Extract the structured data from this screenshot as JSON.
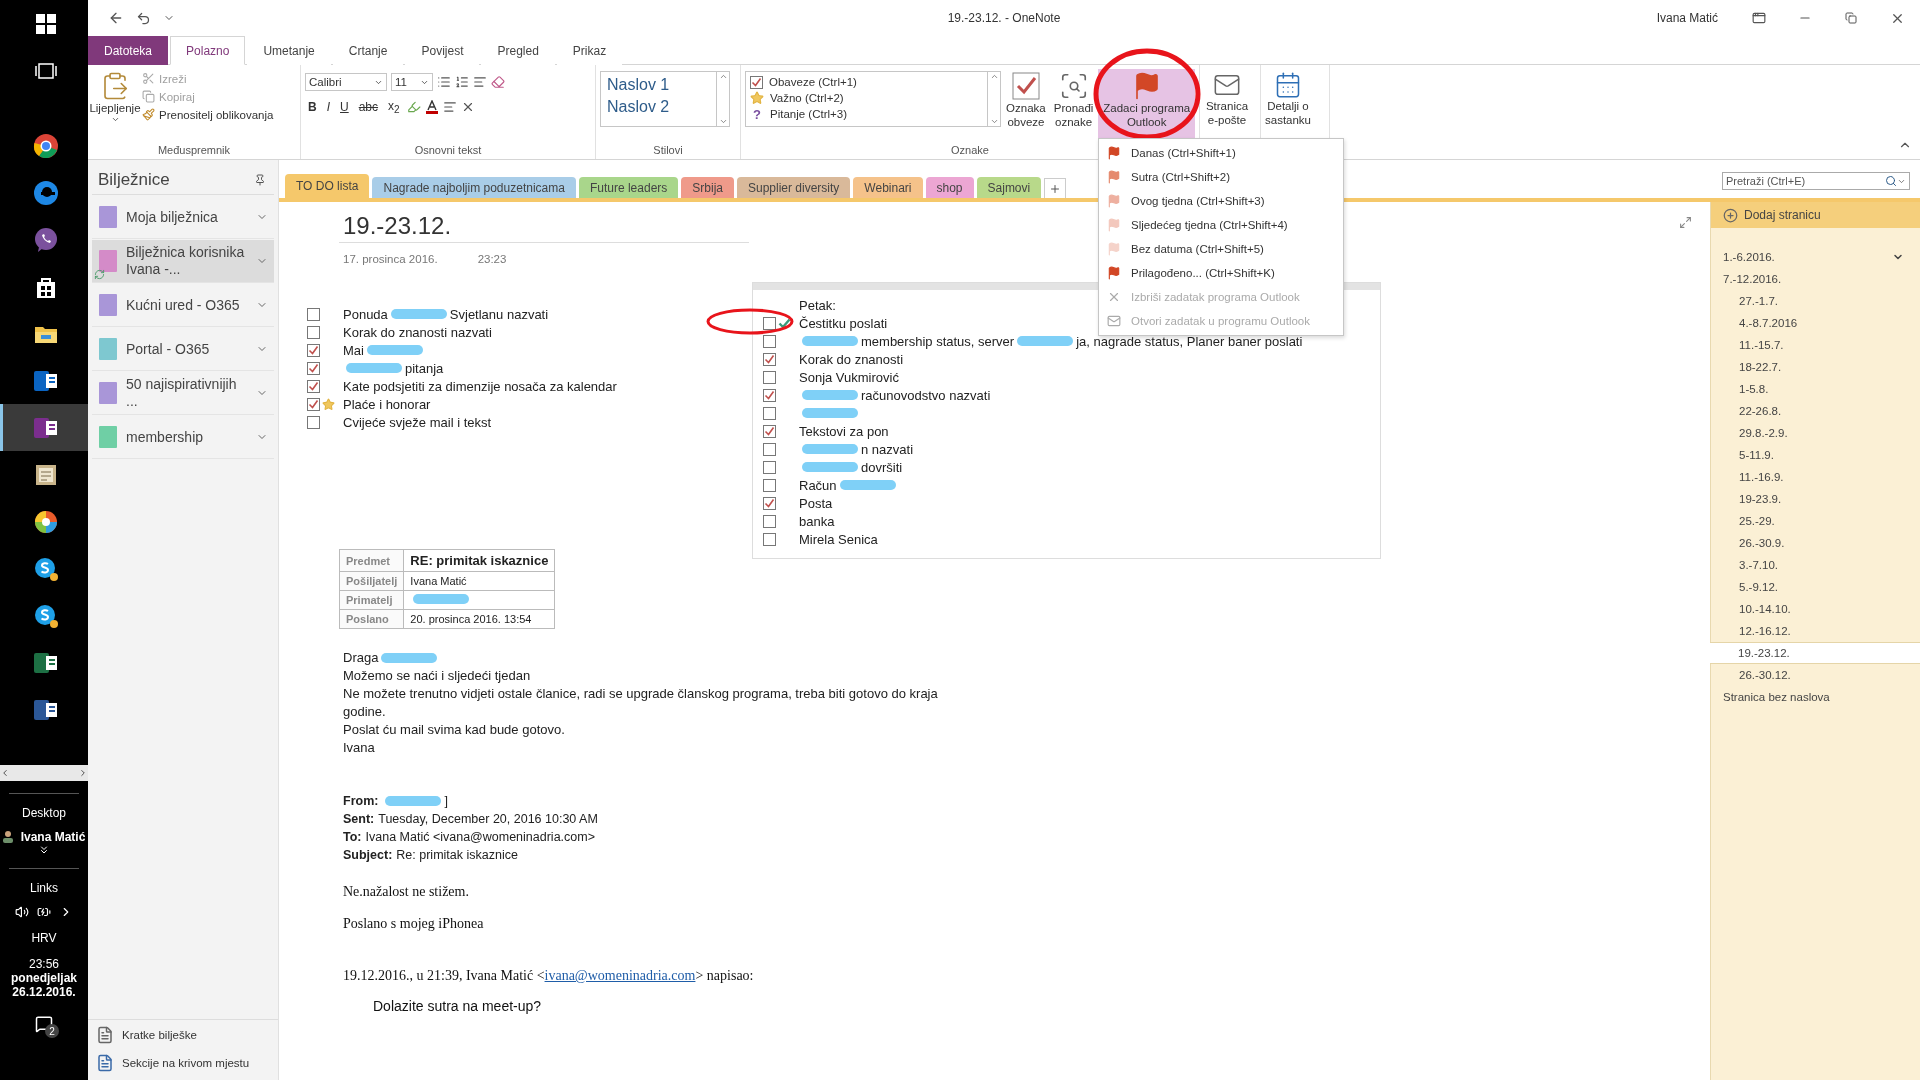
{
  "taskbar": {
    "apps": [
      {
        "kind": "windows",
        "selected": false
      },
      {
        "kind": "taskview",
        "selected": false
      },
      {
        "kind": "chrome",
        "selected": false
      },
      {
        "kind": "edge",
        "selected": false
      },
      {
        "kind": "viber",
        "selected": false
      },
      {
        "kind": "store",
        "selected": false
      },
      {
        "kind": "folder",
        "selected": false
      },
      {
        "kind": "outlook",
        "selected": false
      },
      {
        "kind": "onenote",
        "selected": true
      },
      {
        "kind": "notes",
        "selected": false
      },
      {
        "kind": "paint",
        "selected": false
      },
      {
        "kind": "skype",
        "selected": false
      },
      {
        "kind": "skype",
        "selected": false
      },
      {
        "kind": "excel",
        "selected": false
      },
      {
        "kind": "word",
        "selected": false
      }
    ],
    "desktop": "Desktop",
    "user": "Ivana Matić",
    "links": "Links",
    "language": "HRV",
    "time": "23:56",
    "weekday": "ponedjeljak",
    "date": "26.12.2016.",
    "notifications": "2"
  },
  "title_bar": {
    "title": "19.-23.12.  -  OneNote",
    "user": "Ivana Matić"
  },
  "ribbon_tabs": [
    {
      "label": "Datoteka",
      "kind": "file",
      "selected": false
    },
    {
      "label": "Polazno",
      "kind": "tab",
      "selected": true
    },
    {
      "label": "Umetanje",
      "kind": "tab",
      "selected": false
    },
    {
      "label": "Crtanje",
      "kind": "tab",
      "selected": false
    },
    {
      "label": "Povijest",
      "kind": "tab",
      "selected": false
    },
    {
      "label": "Pregled",
      "kind": "tab",
      "selected": false
    },
    {
      "label": "Prikaz",
      "kind": "tab",
      "selected": false
    }
  ],
  "ribbon": {
    "clipboard": {
      "paste": "Lijepljenje",
      "items": [
        {
          "label": "Izreži",
          "kind": "cut",
          "disabled": true
        },
        {
          "label": "Kopiraj",
          "kind": "copy",
          "disabled": true
        },
        {
          "label": "Prenositelj oblikovanja",
          "kind": "painter",
          "disabled": false
        }
      ],
      "label": "Međuspremnik"
    },
    "basic_text": {
      "font": "Calibri",
      "size": "11",
      "format_buttons": [
        {
          "label": "B",
          "kind": "bold"
        },
        {
          "label": "I",
          "kind": "italic"
        },
        {
          "label": "U",
          "kind": "underline"
        },
        {
          "label": "abc",
          "kind": "strike"
        },
        {
          "label": "x$_{2}$",
          "kind": "subscript"
        }
      ],
      "label": "Osnovni tekst"
    },
    "styles": {
      "items": [
        "Naslov 1",
        "Naslov 2"
      ],
      "label": "Stilovi"
    },
    "tags": {
      "items": [
        {
          "label": "Obaveze (Ctrl+1)",
          "kind": "todo"
        },
        {
          "label": "Važno (Ctrl+2)",
          "kind": "star"
        },
        {
          "label": "Pitanje (Ctrl+3)",
          "kind": "question",
          "glyph": "?"
        }
      ],
      "buttons": [
        {
          "label": "Oznaka obveze",
          "kind": "todo",
          "selected": false
        },
        {
          "label": "Pronađi oznake",
          "kind": "find",
          "selected": false
        },
        {
          "label": "Zadaci programa Outlook",
          "kind": "flag",
          "selected": true
        }
      ],
      "label": "Oznake"
    },
    "email_button": "Stranica e-pošte",
    "meeting_button": "Detalji o sastanku"
  },
  "notebooks": {
    "title": "Bilježnice",
    "items": [
      {
        "label": "Moja bilježnica",
        "color": "#a996d8",
        "selected": false,
        "syncing": false
      },
      {
        "label": "Bilježnica korisnika Ivana -...",
        "color": "#d48bc8",
        "selected": true,
        "syncing": true
      },
      {
        "label": "Kućni ured - O365",
        "color": "#a996d8",
        "selected": false,
        "syncing": false
      },
      {
        "label": "Portal - O365",
        "color": "#7ec8d0",
        "selected": false,
        "syncing": false
      },
      {
        "label": "50 najispirativnijih ...",
        "color": "#a996d8",
        "selected": false,
        "syncing": false
      },
      {
        "label": "membership",
        "color": "#6fcfa5",
        "selected": false,
        "syncing": false
      }
    ],
    "footer": [
      "Kratke bilješke",
      "Sekcije na krivom mjestu"
    ]
  },
  "sections": [
    {
      "label": "TO DO lista",
      "color": "#f5c86b",
      "selected": true
    },
    {
      "label": "Nagrade najboljim poduzetnicama",
      "color": "#a9cde8",
      "selected": false
    },
    {
      "label": "Future leaders",
      "color": "#a9d68b",
      "selected": false
    },
    {
      "label": "Srbija",
      "color": "#ef9a8a",
      "selected": false
    },
    {
      "label": "Supplier diversity",
      "color": "#d9b99a",
      "selected": false
    },
    {
      "label": "Webinari",
      "color": "#f5c28a",
      "selected": false
    },
    {
      "label": "shop",
      "color": "#eca6d3",
      "selected": false
    },
    {
      "label": "Sajmovi",
      "color": "#b8d98a",
      "selected": false
    }
  ],
  "page": {
    "title": "19.-23.12.",
    "date": "17. prosinca 2016.",
    "time": "23:23",
    "tasks": [
      {
        "parts": [
          {
            "kind": "text",
            "text": "Ponuda"
          },
          {
            "kind": "redaction"
          },
          {
            "kind": "text",
            "text": "Svjetlanu nazvati"
          }
        ],
        "checked": false,
        "star": false
      },
      {
        "parts": [
          {
            "kind": "text",
            "text": "Korak do znanosti nazvati"
          }
        ],
        "checked": false,
        "star": false
      },
      {
        "parts": [
          {
            "kind": "text",
            "text": "Mai"
          },
          {
            "kind": "redaction"
          }
        ],
        "checked": true,
        "star": false
      },
      {
        "parts": [
          {
            "kind": "redaction"
          },
          {
            "kind": "text",
            "text": "pitanja"
          }
        ],
        "checked": true,
        "star": false
      },
      {
        "parts": [
          {
            "kind": "text",
            "text": "Kate podsjetiti za dimenzije nosača za kalendar"
          }
        ],
        "checked": true,
        "star": false
      },
      {
        "parts": [
          {
            "kind": "text",
            "text": "Plaće i honorar"
          }
        ],
        "checked": true,
        "star": true
      },
      {
        "parts": [
          {
            "kind": "text",
            "text": "Cvijeće svježe mail i tekst"
          }
        ],
        "checked": false,
        "star": false
      }
    ],
    "friday": {
      "heading": "Petak:",
      "tasks": [
        {
          "parts": [
            {
              "kind": "text",
              "text": "Čestitku poslati"
            }
          ],
          "checked": false,
          "tick": true
        },
        {
          "parts": [
            {
              "kind": "redaction"
            },
            {
              "kind": "text",
              "text": "membership status, server"
            },
            {
              "kind": "redaction"
            },
            {
              "kind": "text",
              "text": "ja, nagrade status, Planer baner poslati"
            }
          ],
          "checked": false,
          "tick": false
        },
        {
          "parts": [
            {
              "kind": "text",
              "text": "Korak do znanosti"
            }
          ],
          "checked": true,
          "tick": false
        },
        {
          "parts": [
            {
              "kind": "text",
              "text": "Sonja Vukmirović"
            }
          ],
          "checked": false,
          "tick": false
        },
        {
          "parts": [
            {
              "kind": "redaction"
            },
            {
              "kind": "text",
              "text": "računovodstvo nazvati"
            }
          ],
          "checked": true,
          "tick": false
        },
        {
          "parts": [
            {
              "kind": "redaction"
            }
          ],
          "checked": false,
          "tick": false
        },
        {
          "parts": [
            {
              "kind": "text",
              "text": "Tekstovi za pon"
            }
          ],
          "checked": true,
          "tick": false
        },
        {
          "parts": [
            {
              "kind": "redaction"
            },
            {
              "kind": "text",
              "text": "n nazvati"
            }
          ],
          "checked": false,
          "tick": false
        },
        {
          "parts": [
            {
              "kind": "redaction"
            },
            {
              "kind": "text",
              "text": "dovršiti"
            }
          ],
          "checked": false,
          "tick": false
        },
        {
          "parts": [
            {
              "kind": "text",
              "text": "Račun"
            },
            {
              "kind": "redaction"
            }
          ],
          "checked": false,
          "tick": false
        },
        {
          "parts": [
            {
              "kind": "text",
              "text": "Posta"
            }
          ],
          "checked": true,
          "tick": false
        },
        {
          "parts": [
            {
              "kind": "text",
              "text": "banka"
            }
          ],
          "checked": false,
          "tick": false
        },
        {
          "parts": [
            {
              "kind": "text",
              "text": "Mirela Senica"
            }
          ],
          "checked": false,
          "tick": false
        }
      ]
    },
    "mail_table": [
      {
        "label": "Predmet",
        "parts": [
          {
            "kind": "text",
            "text": "RE: primitak iskaznice"
          }
        ]
      },
      {
        "label": "Pošiljatelj",
        "parts": [
          {
            "kind": "text",
            "text": "Ivana Matić"
          }
        ]
      },
      {
        "label": "Primatelj",
        "parts": [
          {
            "kind": "redaction"
          }
        ]
      },
      {
        "label": "Poslano",
        "parts": [
          {
            "kind": "text",
            "text": "20. prosinca 2016. 13:54"
          }
        ]
      }
    ],
    "body": [
      {
        "parts": [
          {
            "kind": "text",
            "text": "Draga"
          },
          {
            "kind": "redaction"
          }
        ]
      },
      {
        "parts": [
          {
            "kind": "text",
            "text": "Možemo se naći i sljedeći tjedan"
          }
        ]
      },
      {
        "parts": [
          {
            "kind": "text",
            "text": "Ne možete trenutno vidjeti ostale članice, radi se upgrade članskog programa, treba biti gotovo do kraja godine."
          }
        ]
      },
      {
        "parts": [
          {
            "kind": "text",
            "text": "Poslat ću mail svima kad bude gotovo."
          }
        ]
      },
      {
        "parts": [
          {
            "kind": "text",
            "text": "Ivana"
          }
        ]
      }
    ],
    "headers": [
      {
        "label": "From:",
        "parts": [
          {
            "kind": "redaction"
          },
          {
            "kind": "text",
            "text": "]"
          }
        ]
      },
      {
        "label": "Sent:",
        "parts": [
          {
            "kind": "text",
            "text": "Tuesday, December 20, 2016 10:30 AM"
          }
        ]
      },
      {
        "label": "To:",
        "parts": [
          {
            "kind": "text",
            "text": "Ivana Matić <ivana@womeninadria.com>"
          }
        ]
      },
      {
        "label": "Subject:",
        "parts": [
          {
            "kind": "text",
            "text": "Re: primitak iskaznice"
          }
        ]
      }
    ],
    "reply": "Ne.nažalost ne stižem.",
    "signature": "Poslano s mojeg iPhonea",
    "quote": {
      "before": "19.12.2016., u 21:39, Ivana Matić <",
      "link": "ivana@womeninadria.com",
      "after": "> napisao:"
    },
    "quoted": "Dolazite sutra na meet-up?"
  },
  "page_list": {
    "search": {
      "placeholder": "Pretraži (Ctrl+E)"
    },
    "add_page": "Dodaj stranicu",
    "pages": [
      {
        "title": "1.-6.2016.",
        "hovered": true,
        "selected": false
      },
      {
        "title": "7.-12.2016.",
        "hovered": false,
        "selected": false,
        "children": [
          {
            "title": "27.-1.7.",
            "selected": false
          },
          {
            "title": "4.-8.7.2016",
            "selected": false
          },
          {
            "title": "11.-15.7.",
            "selected": false
          },
          {
            "title": "18-22.7.",
            "selected": false
          },
          {
            "title": "1-5.8.",
            "selected": false
          },
          {
            "title": "22-26.8.",
            "selected": false
          },
          {
            "title": "29.8.-2.9.",
            "selected": false
          },
          {
            "title": "5-11.9.",
            "selected": false
          },
          {
            "title": "11.-16.9.",
            "selected": false
          },
          {
            "title": "19-23.9.",
            "selected": false
          },
          {
            "title": "25.-29.",
            "selected": false
          },
          {
            "title": "26.-30.9.",
            "selected": false
          },
          {
            "title": "3.-7.10.",
            "selected": false
          },
          {
            "title": "5.-9.12.",
            "selected": false
          },
          {
            "title": "10.-14.10.",
            "selected": false
          },
          {
            "title": "12.-16.12.",
            "selected": false
          },
          {
            "title": "19.-23.12.",
            "selected": true
          },
          {
            "title": "26.-30.12.",
            "selected": false
          }
        ]
      },
      {
        "title": "Stranica bez naslova",
        "hovered": false,
        "selected": false
      }
    ]
  },
  "outlook_menu": [
    {
      "label": "Danas (Ctrl+Shift+1)",
      "kind": "flag",
      "color": "#d24726",
      "disabled": false
    },
    {
      "label": "Sutra  (Ctrl+Shift+2)",
      "kind": "flag",
      "color": "#e58a6e",
      "disabled": false
    },
    {
      "label": "Ovog tjedna (Ctrl+Shift+3)",
      "kind": "flag",
      "color": "#eeb0a0",
      "disabled": false
    },
    {
      "label": "Sljedećeg tjedna  (Ctrl+Shift+4)",
      "kind": "flag",
      "color": "#f3c8bd",
      "disabled": false
    },
    {
      "label": "Bez datuma (Ctrl+Shift+5)",
      "kind": "flag",
      "color": "#f5d3ca",
      "disabled": false
    },
    {
      "label": "Prilagođeno...  (Ctrl+Shift+K)",
      "kind": "flag",
      "color": "#d24726",
      "disabled": false
    },
    {
      "label": "Izbriši zadatak programa Outlook",
      "kind": "delete",
      "disabled": true
    },
    {
      "label": "Otvori zadatak u programu Outlook",
      "kind": "open",
      "disabled": true
    }
  ]
}
